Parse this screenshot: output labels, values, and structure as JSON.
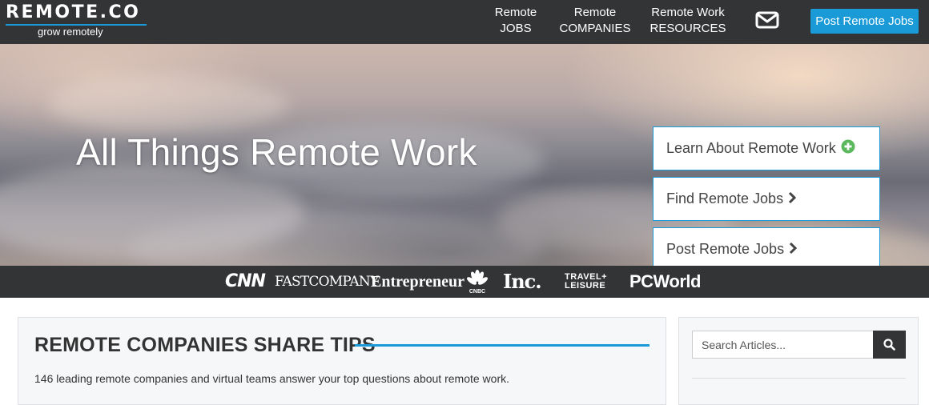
{
  "header": {
    "logo": {
      "name": "REMOTE.CO",
      "tagline": "grow remotely"
    },
    "nav": [
      {
        "line1": "Remote",
        "line2": "JOBS"
      },
      {
        "line1": "Remote",
        "line2": "COMPANIES"
      },
      {
        "line1": "Remote Work",
        "line2": "RESOURCES"
      }
    ],
    "mail_icon": "envelope-icon",
    "post_button": "Post Remote Jobs"
  },
  "hero": {
    "title": "All Things Remote Work",
    "cta": [
      {
        "label": "Learn About Remote Work",
        "icon": "plus-circle-icon"
      },
      {
        "label": "Find Remote Jobs",
        "icon": "chevron-right-icon"
      },
      {
        "label": "Post Remote Jobs",
        "icon": "chevron-right-icon"
      }
    ]
  },
  "press": {
    "cnn": "CNN",
    "fast_company": "FASTCOMPANY",
    "entrepreneur": "Entrepreneur",
    "cnbc": "CNBC",
    "inc": "Inc.",
    "travel_leisure_1": "TRAVEL+",
    "travel_leisure_2": "LEISURE",
    "pcworld": "PCWorld"
  },
  "main": {
    "section_title": "REMOTE COMPANIES SHARE TIPS",
    "section_desc": "146 leading remote companies and virtual teams answer your top questions about remote work."
  },
  "sidebar": {
    "search_placeholder": "Search Articles...",
    "search_icon": "magnifier-icon"
  },
  "colors": {
    "accent": "#1a9bd8",
    "nav_bg": "#333436",
    "plus_green": "#5cb85c"
  }
}
